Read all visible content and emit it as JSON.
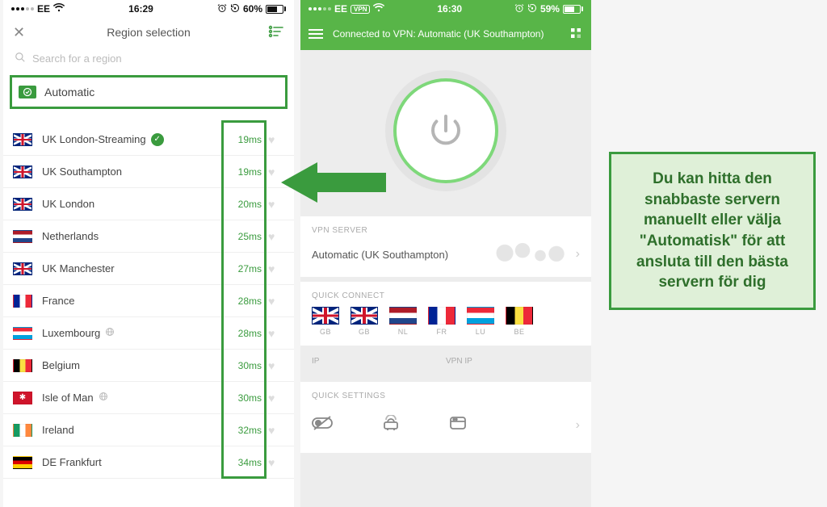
{
  "phone1": {
    "status": {
      "carrier": "EE",
      "time": "16:29",
      "battery_pct": "60%",
      "alarm_icon": "alarm-icon"
    },
    "nav_title": "Region selection",
    "search_placeholder": "Search for a region",
    "automatic_label": "Automatic",
    "regions": [
      {
        "name": "UK London-Streaming",
        "ping": "19ms",
        "flag": "uk",
        "checked": true
      },
      {
        "name": "UK Southampton",
        "ping": "19ms",
        "flag": "uk"
      },
      {
        "name": "UK London",
        "ping": "20ms",
        "flag": "uk"
      },
      {
        "name": "Netherlands",
        "ping": "25ms",
        "flag": "nl"
      },
      {
        "name": "UK Manchester",
        "ping": "27ms",
        "flag": "uk"
      },
      {
        "name": "France",
        "ping": "28ms",
        "flag": "fr"
      },
      {
        "name": "Luxembourg",
        "ping": "28ms",
        "flag": "lu",
        "geo": true
      },
      {
        "name": "Belgium",
        "ping": "30ms",
        "flag": "be"
      },
      {
        "name": "Isle of Man",
        "ping": "30ms",
        "flag": "im",
        "geo": true
      },
      {
        "name": "Ireland",
        "ping": "32ms",
        "flag": "ie"
      },
      {
        "name": "DE Frankfurt",
        "ping": "34ms",
        "flag": "de"
      }
    ]
  },
  "phone2": {
    "status": {
      "carrier": "EE",
      "vpn_badge": "VPN",
      "time": "16:30",
      "battery_pct": "59%"
    },
    "nav_title": "Connected to VPN: Automatic (UK Southampton)",
    "vpn_server_label": "VPN SERVER",
    "vpn_server_value": "Automatic (UK Southampton)",
    "quick_connect_label": "QUICK CONNECT",
    "quick_connect": [
      {
        "flag": "uk",
        "code": "GB"
      },
      {
        "flag": "uk",
        "code": "GB"
      },
      {
        "flag": "nl",
        "code": "NL"
      },
      {
        "flag": "fr",
        "code": "FR"
      },
      {
        "flag": "lu",
        "code": "LU"
      },
      {
        "flag": "be",
        "code": "BE"
      }
    ],
    "ip_label": "IP",
    "vpn_ip_label": "VPN IP",
    "quick_settings_label": "QUICK SETTINGS"
  },
  "callout": "Du kan hitta den snabbaste servern manuellt eller välja \"Automatisk\" för att ansluta till den bästa servern för dig"
}
